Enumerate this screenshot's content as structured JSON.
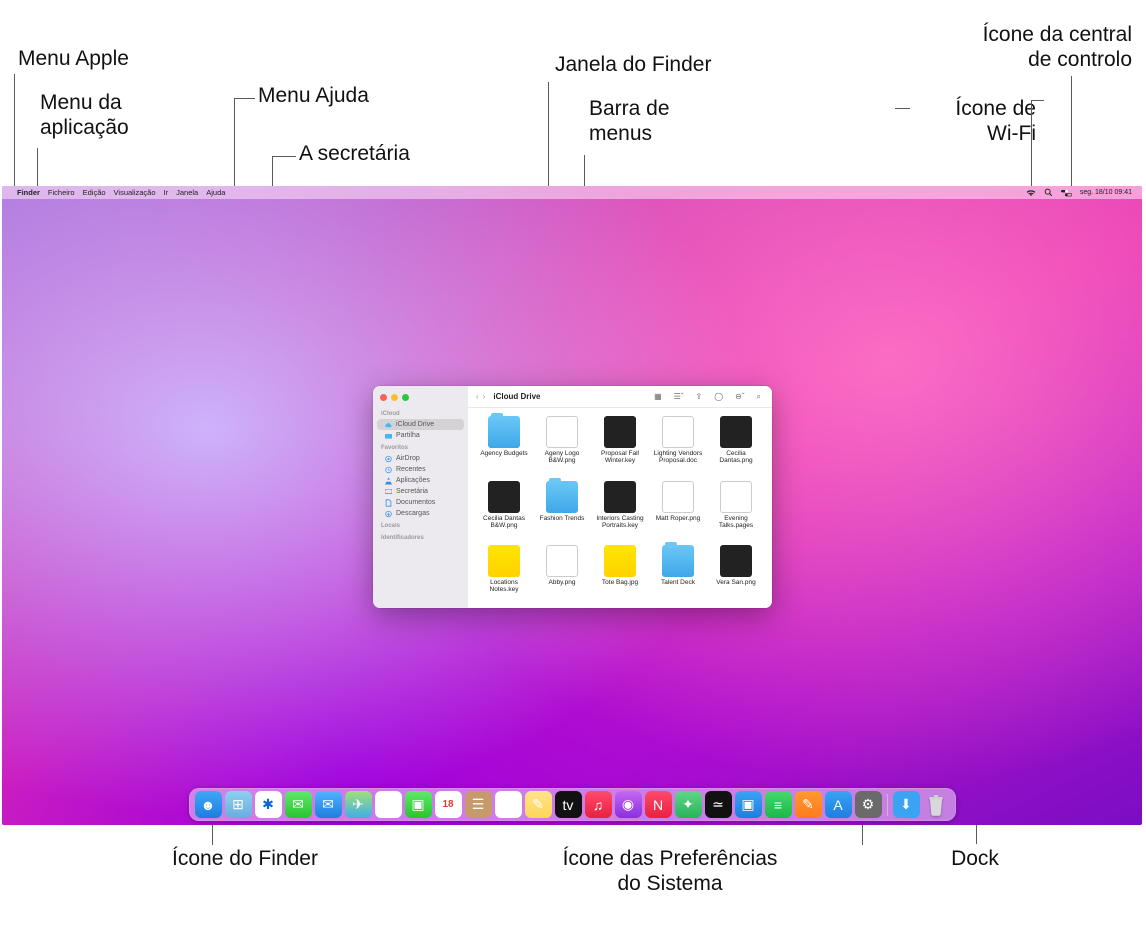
{
  "callouts": {
    "apple_menu": "Menu Apple",
    "app_menu": "Menu da\naplicação",
    "help_menu": "Menu Ajuda",
    "desktop": "A secretária",
    "finder_window": "Janela do Finder",
    "menubar": "Barra de\nmenus",
    "control_center": "Ícone da central\nde controlo",
    "wifi": "Ícone de\nWi-Fi",
    "finder_icon": "Ícone do Finder",
    "sysprefs_icon": "Ícone das Preferências\ndo Sistema",
    "dock": "Dock"
  },
  "menubar": {
    "items": [
      "Finder",
      "Ficheiro",
      "Edição",
      "Visualização",
      "Ir",
      "Janela",
      "Ajuda"
    ],
    "datetime": "seg. 18/10 09:41"
  },
  "finder": {
    "title": "iCloud Drive",
    "sidebar": {
      "sections": [
        {
          "label": "iCloud",
          "items": [
            "iCloud Drive",
            "Partilha"
          ]
        },
        {
          "label": "Favoritos",
          "items": [
            "AirDrop",
            "Recentes",
            "Aplicações",
            "Secretária",
            "Documentos",
            "Descargas"
          ]
        },
        {
          "label": "Locais",
          "items": []
        },
        {
          "label": "Identificadores",
          "items": []
        }
      ],
      "selected": "iCloud Drive"
    },
    "files": [
      {
        "name": "Agency Budgets",
        "kind": "folder"
      },
      {
        "name": "Ageny Logo B&W.png",
        "kind": "doc"
      },
      {
        "name": "Proposal Fall Winter.key",
        "kind": "dark"
      },
      {
        "name": "Lighting Vendors Proposal.doc",
        "kind": "doc"
      },
      {
        "name": "Cecilia Dantas.png",
        "kind": "dark"
      },
      {
        "name": "Cecilia Dantas B&W.png",
        "kind": "dark"
      },
      {
        "name": "Fashion Trends",
        "kind": "folder"
      },
      {
        "name": "Interiors Casting Portraits.key",
        "kind": "dark"
      },
      {
        "name": "Matt Roper.png",
        "kind": "doc"
      },
      {
        "name": "Evening Talks.pages",
        "kind": "doc"
      },
      {
        "name": "Locations Notes.key",
        "kind": "yellow"
      },
      {
        "name": "Abby.png",
        "kind": "doc"
      },
      {
        "name": "Tote Bag.jpg",
        "kind": "yellow"
      },
      {
        "name": "Talent Deck",
        "kind": "folder"
      },
      {
        "name": "Vera San.png",
        "kind": "dark"
      }
    ]
  },
  "dock": {
    "calendar_day": "18",
    "apps": [
      "finder",
      "launchpad",
      "safari",
      "messages",
      "mail",
      "maps",
      "photos",
      "facetime",
      "calendar",
      "contacts",
      "reminders",
      "notes",
      "tv",
      "music",
      "podcasts",
      "news",
      "books",
      "stocks",
      "keynote",
      "numbers",
      "pages",
      "appstore",
      "sysprefs"
    ],
    "right": [
      "downloads",
      "trash"
    ]
  }
}
